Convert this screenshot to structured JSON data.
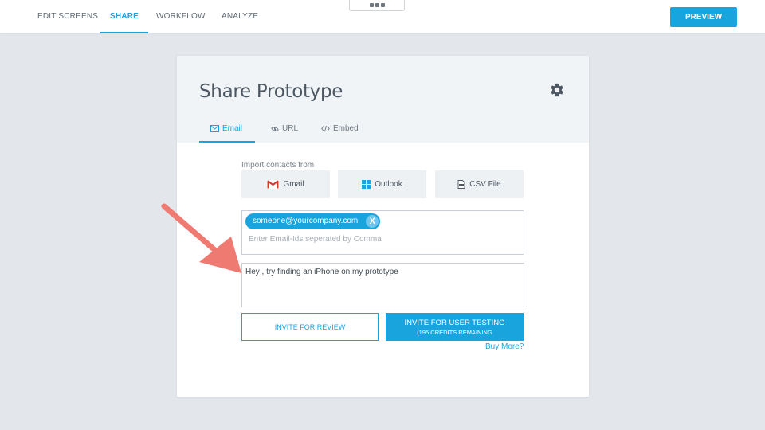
{
  "nav": {
    "tabs": [
      {
        "label": "EDIT SCREENS"
      },
      {
        "label": "SHARE"
      },
      {
        "label": "WORKFLOW"
      },
      {
        "label": "ANALYZE"
      }
    ],
    "active_tab": "SHARE",
    "preview_label": "PREVIEW"
  },
  "panel": {
    "title": "Share Prototype",
    "settings_icon": "gear-icon",
    "tabs": [
      {
        "label": "Email",
        "icon": "envelope-icon"
      },
      {
        "label": "URL",
        "icon": "link-icon"
      },
      {
        "label": "Embed",
        "icon": "code-icon"
      }
    ],
    "active_tab": "Email"
  },
  "import": {
    "label": "Import contacts from",
    "sources": [
      {
        "label": "Gmail",
        "icon": "gmail-icon"
      },
      {
        "label": "Outlook",
        "icon": "windows-icon"
      },
      {
        "label": "CSV File",
        "icon": "csv-file-icon"
      }
    ]
  },
  "recipients": {
    "chip": "someone@yourcompany.com",
    "chip_remove": "X",
    "placeholder": "Enter Email-Ids seperated by Comma"
  },
  "message": {
    "value": "Hey , try finding an iPhone on my prototype"
  },
  "actions": {
    "invite_review": "INVITE FOR REVIEW",
    "invite_testing": "INVITE FOR USER TESTING",
    "credits": "(195 CREDITS REMAINING",
    "buy_more": "Buy More?"
  },
  "colors": {
    "accent": "#1aa4de",
    "background": "#e3e6ea",
    "annotation_arrow": "#ef7a72"
  }
}
